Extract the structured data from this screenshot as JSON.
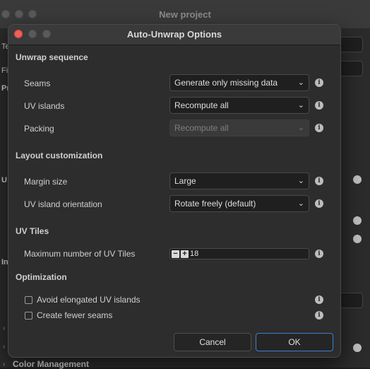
{
  "background_window": {
    "title": "New project",
    "labels": [
      "Te",
      "Fi",
      "Pr",
      "U",
      "In"
    ],
    "section_footer": "Color Management"
  },
  "dialog": {
    "title": "Auto-Unwrap Options",
    "sections": {
      "unwrap_sequence": "Unwrap sequence",
      "layout_customization": "Layout customization",
      "uv_tiles": "UV Tiles",
      "optimization": "Optimization"
    },
    "rows": {
      "seams": {
        "label": "Seams",
        "value": "Generate only missing data"
      },
      "uv_islands": {
        "label": "UV islands",
        "value": "Recompute all"
      },
      "packing": {
        "label": "Packing",
        "value": "Recompute all",
        "disabled": true
      },
      "margin_size": {
        "label": "Margin size",
        "value": "Large"
      },
      "uv_island_orientation": {
        "label": "UV island orientation",
        "value": "Rotate freely (default)"
      },
      "max_uv_tiles": {
        "label": "Maximum number of UV Tiles",
        "value": "18"
      }
    },
    "checkboxes": {
      "avoid_elongated": {
        "label": "Avoid elongated UV islands",
        "checked": false
      },
      "fewer_seams": {
        "label": "Create fewer seams",
        "checked": false
      }
    },
    "buttons": {
      "cancel": "Cancel",
      "ok": "OK"
    },
    "icons": {
      "info": "info-icon",
      "chevron": "chevron-down-icon",
      "minus": "minus-icon",
      "plus": "plus-icon"
    },
    "colors": {
      "ok_border": "#3d7fd0",
      "close_light": "#ee5f57"
    }
  }
}
